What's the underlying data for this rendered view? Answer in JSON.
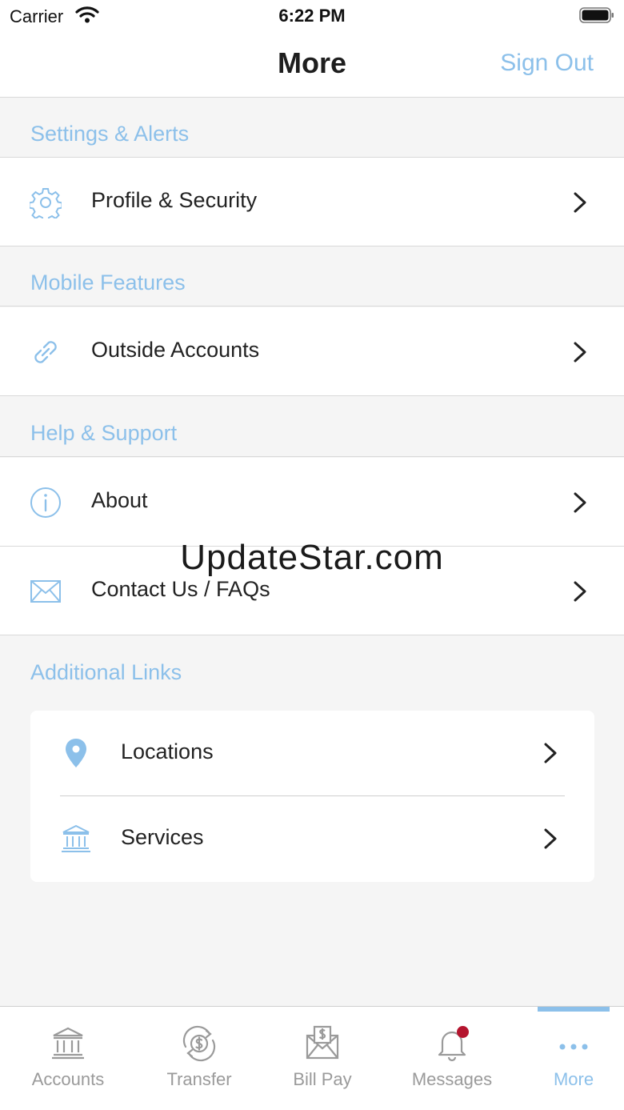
{
  "status_bar": {
    "carrier": "Carrier",
    "time": "6:22 PM",
    "icons": [
      "wifi-icon",
      "battery-icon"
    ]
  },
  "nav": {
    "title": "More",
    "sign_out": "Sign Out"
  },
  "sections": [
    {
      "title": "Settings & Alerts",
      "items": [
        {
          "label": "Profile & Security",
          "icon": "gear-icon"
        }
      ]
    },
    {
      "title": "Mobile Features",
      "items": [
        {
          "label": "Outside Accounts",
          "icon": "link-icon"
        }
      ]
    },
    {
      "title": "Help & Support",
      "items": [
        {
          "label": "About",
          "icon": "info-icon"
        },
        {
          "label": "Contact Us / FAQs",
          "icon": "envelope-icon"
        }
      ]
    },
    {
      "title": "Additional Links",
      "items": [
        {
          "label": "Locations",
          "icon": "location-pin-icon"
        },
        {
          "label": "Services",
          "icon": "bank-icon"
        }
      ]
    }
  ],
  "watermark": "UpdateStar.com",
  "tabs": [
    {
      "label": "Accounts",
      "icon": "bank-icon"
    },
    {
      "label": "Transfer",
      "icon": "transfer-icon"
    },
    {
      "label": "Bill Pay",
      "icon": "bill-pay-icon"
    },
    {
      "label": "Messages",
      "icon": "bell-icon"
    },
    {
      "label": "More",
      "icon": "more-dots-icon",
      "active": true
    }
  ],
  "colors": {
    "accent": "#8cc0ea",
    "inactive_tab": "#9a9a9a",
    "notification": "#b4142e",
    "background": "#f5f5f5"
  }
}
